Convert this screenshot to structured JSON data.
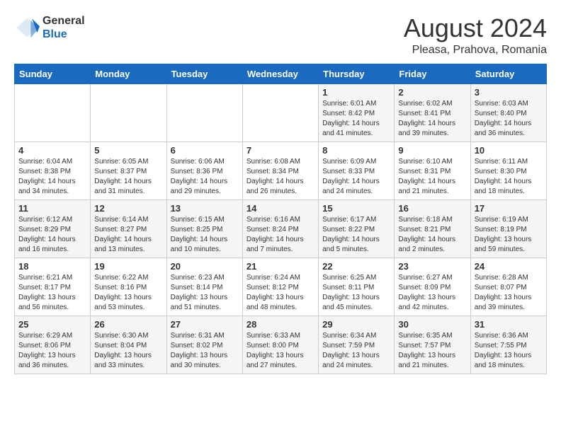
{
  "logo": {
    "general": "General",
    "blue": "Blue"
  },
  "header": {
    "title": "August 2024",
    "subtitle": "Pleasa, Prahova, Romania"
  },
  "weekdays": [
    "Sunday",
    "Monday",
    "Tuesday",
    "Wednesday",
    "Thursday",
    "Friday",
    "Saturday"
  ],
  "weeks": [
    [
      {
        "day": "",
        "info": ""
      },
      {
        "day": "",
        "info": ""
      },
      {
        "day": "",
        "info": ""
      },
      {
        "day": "",
        "info": ""
      },
      {
        "day": "1",
        "info": "Sunrise: 6:01 AM\nSunset: 8:42 PM\nDaylight: 14 hours and 41 minutes."
      },
      {
        "day": "2",
        "info": "Sunrise: 6:02 AM\nSunset: 8:41 PM\nDaylight: 14 hours and 39 minutes."
      },
      {
        "day": "3",
        "info": "Sunrise: 6:03 AM\nSunset: 8:40 PM\nDaylight: 14 hours and 36 minutes."
      }
    ],
    [
      {
        "day": "4",
        "info": "Sunrise: 6:04 AM\nSunset: 8:38 PM\nDaylight: 14 hours and 34 minutes."
      },
      {
        "day": "5",
        "info": "Sunrise: 6:05 AM\nSunset: 8:37 PM\nDaylight: 14 hours and 31 minutes."
      },
      {
        "day": "6",
        "info": "Sunrise: 6:06 AM\nSunset: 8:36 PM\nDaylight: 14 hours and 29 minutes."
      },
      {
        "day": "7",
        "info": "Sunrise: 6:08 AM\nSunset: 8:34 PM\nDaylight: 14 hours and 26 minutes."
      },
      {
        "day": "8",
        "info": "Sunrise: 6:09 AM\nSunset: 8:33 PM\nDaylight: 14 hours and 24 minutes."
      },
      {
        "day": "9",
        "info": "Sunrise: 6:10 AM\nSunset: 8:31 PM\nDaylight: 14 hours and 21 minutes."
      },
      {
        "day": "10",
        "info": "Sunrise: 6:11 AM\nSunset: 8:30 PM\nDaylight: 14 hours and 18 minutes."
      }
    ],
    [
      {
        "day": "11",
        "info": "Sunrise: 6:12 AM\nSunset: 8:29 PM\nDaylight: 14 hours and 16 minutes."
      },
      {
        "day": "12",
        "info": "Sunrise: 6:14 AM\nSunset: 8:27 PM\nDaylight: 14 hours and 13 minutes."
      },
      {
        "day": "13",
        "info": "Sunrise: 6:15 AM\nSunset: 8:25 PM\nDaylight: 14 hours and 10 minutes."
      },
      {
        "day": "14",
        "info": "Sunrise: 6:16 AM\nSunset: 8:24 PM\nDaylight: 14 hours and 7 minutes."
      },
      {
        "day": "15",
        "info": "Sunrise: 6:17 AM\nSunset: 8:22 PM\nDaylight: 14 hours and 5 minutes."
      },
      {
        "day": "16",
        "info": "Sunrise: 6:18 AM\nSunset: 8:21 PM\nDaylight: 14 hours and 2 minutes."
      },
      {
        "day": "17",
        "info": "Sunrise: 6:19 AM\nSunset: 8:19 PM\nDaylight: 13 hours and 59 minutes."
      }
    ],
    [
      {
        "day": "18",
        "info": "Sunrise: 6:21 AM\nSunset: 8:17 PM\nDaylight: 13 hours and 56 minutes."
      },
      {
        "day": "19",
        "info": "Sunrise: 6:22 AM\nSunset: 8:16 PM\nDaylight: 13 hours and 53 minutes."
      },
      {
        "day": "20",
        "info": "Sunrise: 6:23 AM\nSunset: 8:14 PM\nDaylight: 13 hours and 51 minutes."
      },
      {
        "day": "21",
        "info": "Sunrise: 6:24 AM\nSunset: 8:12 PM\nDaylight: 13 hours and 48 minutes."
      },
      {
        "day": "22",
        "info": "Sunrise: 6:25 AM\nSunset: 8:11 PM\nDaylight: 13 hours and 45 minutes."
      },
      {
        "day": "23",
        "info": "Sunrise: 6:27 AM\nSunset: 8:09 PM\nDaylight: 13 hours and 42 minutes."
      },
      {
        "day": "24",
        "info": "Sunrise: 6:28 AM\nSunset: 8:07 PM\nDaylight: 13 hours and 39 minutes."
      }
    ],
    [
      {
        "day": "25",
        "info": "Sunrise: 6:29 AM\nSunset: 8:06 PM\nDaylight: 13 hours and 36 minutes."
      },
      {
        "day": "26",
        "info": "Sunrise: 6:30 AM\nSunset: 8:04 PM\nDaylight: 13 hours and 33 minutes."
      },
      {
        "day": "27",
        "info": "Sunrise: 6:31 AM\nSunset: 8:02 PM\nDaylight: 13 hours and 30 minutes."
      },
      {
        "day": "28",
        "info": "Sunrise: 6:33 AM\nSunset: 8:00 PM\nDaylight: 13 hours and 27 minutes."
      },
      {
        "day": "29",
        "info": "Sunrise: 6:34 AM\nSunset: 7:59 PM\nDaylight: 13 hours and 24 minutes."
      },
      {
        "day": "30",
        "info": "Sunrise: 6:35 AM\nSunset: 7:57 PM\nDaylight: 13 hours and 21 minutes."
      },
      {
        "day": "31",
        "info": "Sunrise: 6:36 AM\nSunset: 7:55 PM\nDaylight: 13 hours and 18 minutes."
      }
    ]
  ]
}
